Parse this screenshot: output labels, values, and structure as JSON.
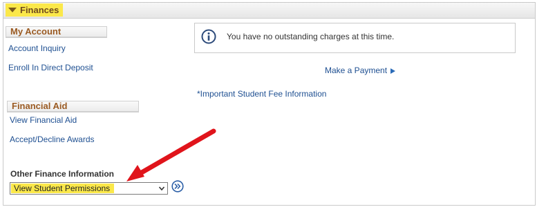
{
  "panel": {
    "title": "Finances",
    "highlight_color": "#fbe84a"
  },
  "my_account": {
    "heading": "My Account",
    "links": [
      "Account Inquiry",
      "Enroll In Direct Deposit"
    ]
  },
  "financial_aid": {
    "heading": "Financial Aid",
    "links": [
      "View Financial Aid",
      "Accept/Decline Awards"
    ]
  },
  "notice": {
    "icon": "info-icon",
    "message": "You have no outstanding charges at this time."
  },
  "actions": {
    "make_payment": "Make a Payment",
    "fee_info": "*Important Student Fee Information"
  },
  "other_finance": {
    "label": "Other Finance Information",
    "selected": "View Student Permissions",
    "go_icon": "double-chevron-right-icon"
  },
  "annotation": {
    "arrow_color": "#e0141b"
  }
}
